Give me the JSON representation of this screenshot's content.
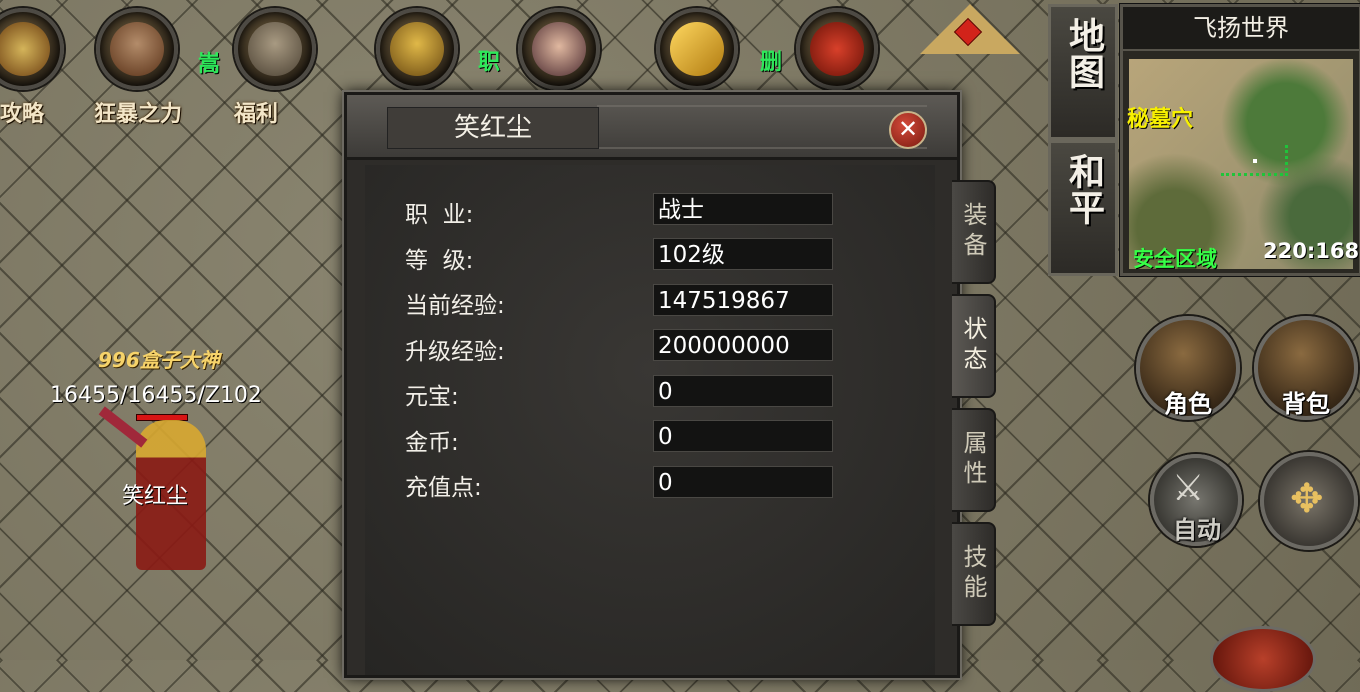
{
  "top_bar": {
    "items": [
      {
        "label": "攻略",
        "icon": "guide-icon"
      },
      {
        "label": "狂暴之力",
        "icon": "berserk-demon-icon"
      },
      {
        "label": "福利",
        "icon": "welfare-gate-icon"
      },
      {
        "label": "",
        "icon": "warrior-helmet-icon"
      },
      {
        "label": "",
        "icon": "female-portrait-icon"
      },
      {
        "label": "",
        "icon": "gold-bars-icon"
      },
      {
        "label": "",
        "icon": "treasure-chest-icon"
      }
    ],
    "green_partial_1": "职",
    "green_partial_2": "删"
  },
  "character_panel": {
    "title": "笑红尘",
    "rows": [
      {
        "label": "职  业:",
        "value": "战士"
      },
      {
        "label": "等  级:",
        "value": "102级"
      },
      {
        "label": "当前经验:",
        "value": "147519867"
      },
      {
        "label": "升级经验:",
        "value": "200000000"
      },
      {
        "label": "元宝:",
        "value": "0"
      },
      {
        "label": "金币:",
        "value": "0"
      },
      {
        "label": "充值点:",
        "value": "0"
      }
    ],
    "tabs": [
      "装备",
      "状态",
      "属性",
      "技能"
    ],
    "active_tab": "状态"
  },
  "minimap": {
    "map_button": "地图",
    "mode_button": "和平",
    "server_name": "飞扬世界",
    "location_name": "秘墓穴",
    "zone": "安全区域",
    "coords": "220:168"
  },
  "right_buttons": {
    "character": "角色",
    "bag": "背包",
    "auto": "自动"
  },
  "player": {
    "title": "996盒子大神",
    "stats": "16455/16455/Z102",
    "name": "笑红尘"
  },
  "colors": {
    "green_text": "#2ee85a",
    "map_label_yellow": "#f7f000",
    "safe_zone_green": "#35ff46",
    "player_title_gold": "#f6d36a"
  }
}
